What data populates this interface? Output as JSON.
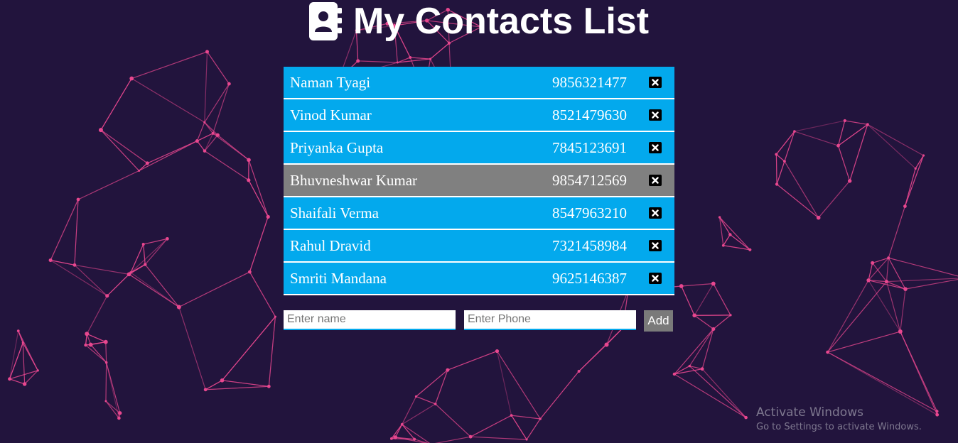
{
  "header": {
    "title": "My Contacts List",
    "icon": "address-book-icon"
  },
  "contacts": [
    {
      "name": "Naman Tyagi",
      "phone": "9856321477",
      "selected": false
    },
    {
      "name": "Vinod Kumar",
      "phone": "8521479630",
      "selected": false
    },
    {
      "name": "Priyanka Gupta",
      "phone": "7845123691",
      "selected": false
    },
    {
      "name": "Bhuvneshwar Kumar",
      "phone": "9854712569",
      "selected": true
    },
    {
      "name": "Shaifali Verma",
      "phone": "8547963210",
      "selected": false
    },
    {
      "name": "Rahul Dravid",
      "phone": "7321458984",
      "selected": false
    },
    {
      "name": "Smriti Mandana",
      "phone": "9625146387",
      "selected": false
    }
  ],
  "form": {
    "name_placeholder": "Enter name",
    "phone_placeholder": "Enter Phone",
    "add_label": "Add"
  },
  "watermark": {
    "title": "Activate Windows",
    "subtitle": "Go to Settings to activate Windows."
  },
  "colors": {
    "background": "#22143d",
    "network_lines": "#e8478f",
    "row": "#03a9ed",
    "row_selected": "#808080",
    "add_button": "#7a7a7a"
  }
}
